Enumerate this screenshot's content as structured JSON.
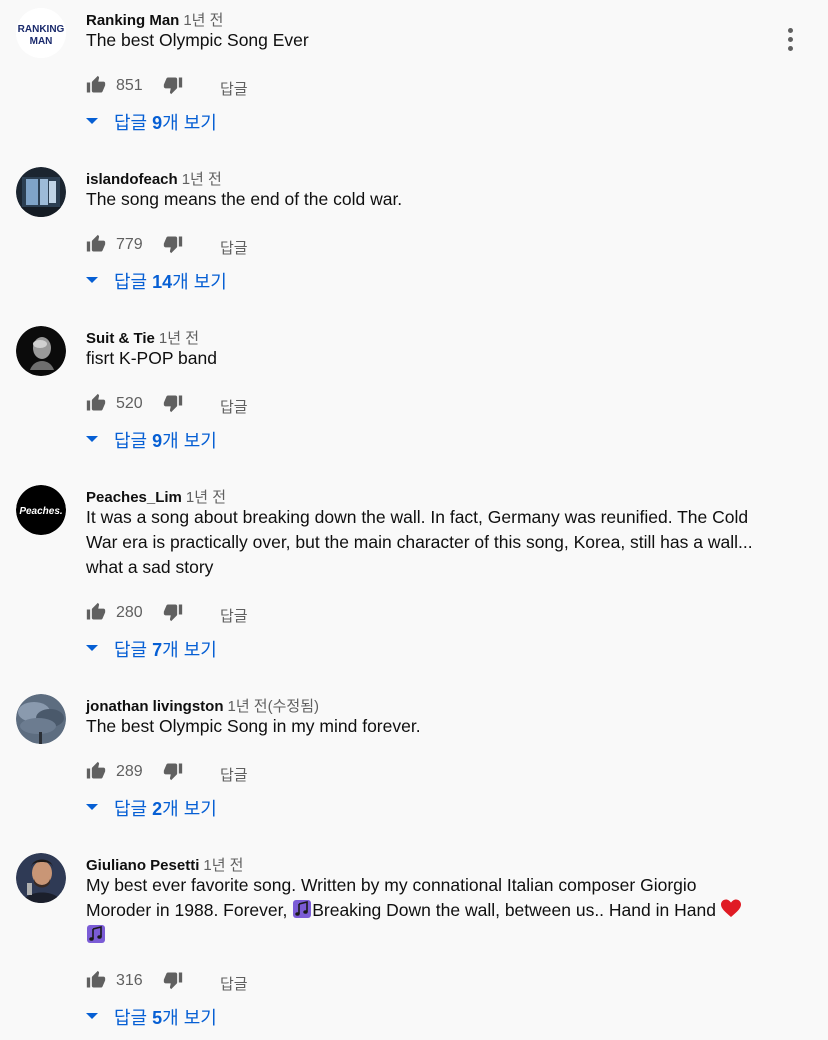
{
  "comments": [
    {
      "author": "Ranking Man",
      "time": "1년 전",
      "text": "The best Olympic Song Ever",
      "likes": "851",
      "reply_label": "답글",
      "replies_prefix": "답글 ",
      "replies_count": "9",
      "replies_suffix": "개 보기",
      "avatar_text_1": "RANKING",
      "avatar_text_2": "MAN"
    },
    {
      "author": "islandofeach",
      "time": "1년 전",
      "text": "The song means the end of the cold war.",
      "likes": "779",
      "reply_label": "답글",
      "replies_prefix": "답글 ",
      "replies_count": "14",
      "replies_suffix": "개 보기"
    },
    {
      "author": "Suit & Tie",
      "time": "1년 전",
      "text": "fisrt K-POP band",
      "likes": "520",
      "reply_label": "답글",
      "replies_prefix": "답글 ",
      "replies_count": "9",
      "replies_suffix": "개 보기"
    },
    {
      "author": "Peaches_Lim",
      "time": "1년 전",
      "text": "It was a song about breaking down the wall. In fact, Germany was reunified. The Cold War era is practically over, but the main character of this song, Korea, still has a wall... what a sad story",
      "likes": "280",
      "reply_label": "답글",
      "replies_prefix": "답글 ",
      "replies_count": "7",
      "replies_suffix": "개 보기",
      "avatar_text_1": "Peaches."
    },
    {
      "author": "jonathan livingston",
      "time": "1년 전(수정됨)",
      "text": "The best Olympic Song in my mind forever.",
      "likes": "289",
      "reply_label": "답글",
      "replies_prefix": "답글 ",
      "replies_count": "2",
      "replies_suffix": "개 보기"
    },
    {
      "author": "Giuliano Pesetti",
      "time": "1년 전",
      "text_part1": "My best ever favorite song.  Written by my connational Italian composer Giorgio Moroder in 1988. Forever,  ",
      "text_part2": "Breaking Down  the wall, between us.. Hand in Hand ",
      "likes": "316",
      "reply_label": "답글",
      "replies_prefix": "답글 ",
      "replies_count": "5",
      "replies_suffix": "개 보기"
    }
  ],
  "colors": {
    "background": "#f9f9f9",
    "link_blue": "#065fd4",
    "secondary_text": "#606060",
    "heart_red": "#e01b24",
    "music_purple": "#7b5cd6"
  }
}
